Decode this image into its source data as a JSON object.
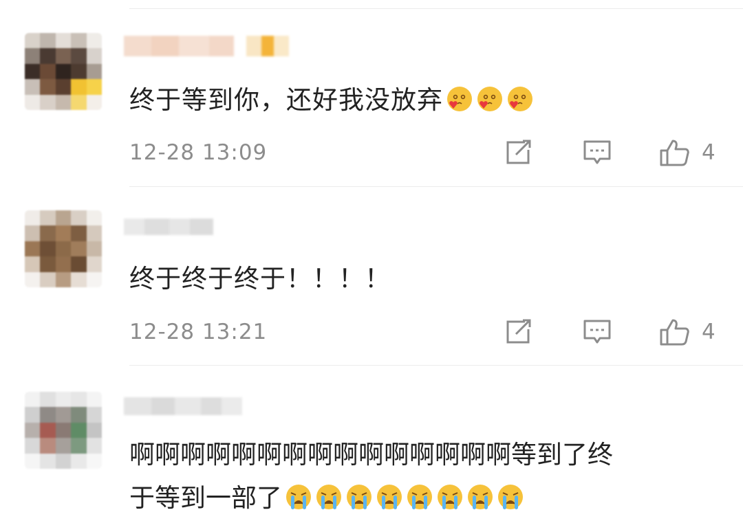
{
  "comments": [
    {
      "text": "终于等到你，还好我没放弃",
      "emoji": [
        "blush-emoji",
        "blush-emoji",
        "blush-emoji"
      ],
      "time": "12-28 13:09",
      "likes": "4"
    },
    {
      "text": "终于终于终于！！！！",
      "emoji": [],
      "time": "12-28 13:21",
      "likes": "4"
    },
    {
      "text_line1": "啊啊啊啊啊啊啊啊啊啊啊啊啊啊啊等到了终",
      "text_line2": "于等到一部了",
      "emoji": [
        "crying-emoji",
        "crying-emoji",
        "crying-emoji",
        "crying-emoji",
        "crying-emoji",
        "crying-emoji",
        "crying-emoji",
        "crying-emoji"
      ]
    }
  ],
  "colors": {
    "text": "#222222",
    "meta": "#8c8c8c",
    "divider": "#ececec",
    "blush_face": "#f6c23a",
    "cry_face": "#f6c23a",
    "tear": "#5ab4f0",
    "heart": "#e8383d"
  },
  "icons": {
    "reply": "share-edit-icon",
    "comment": "comment-bubble-icon",
    "like": "thumbs-up-icon"
  }
}
